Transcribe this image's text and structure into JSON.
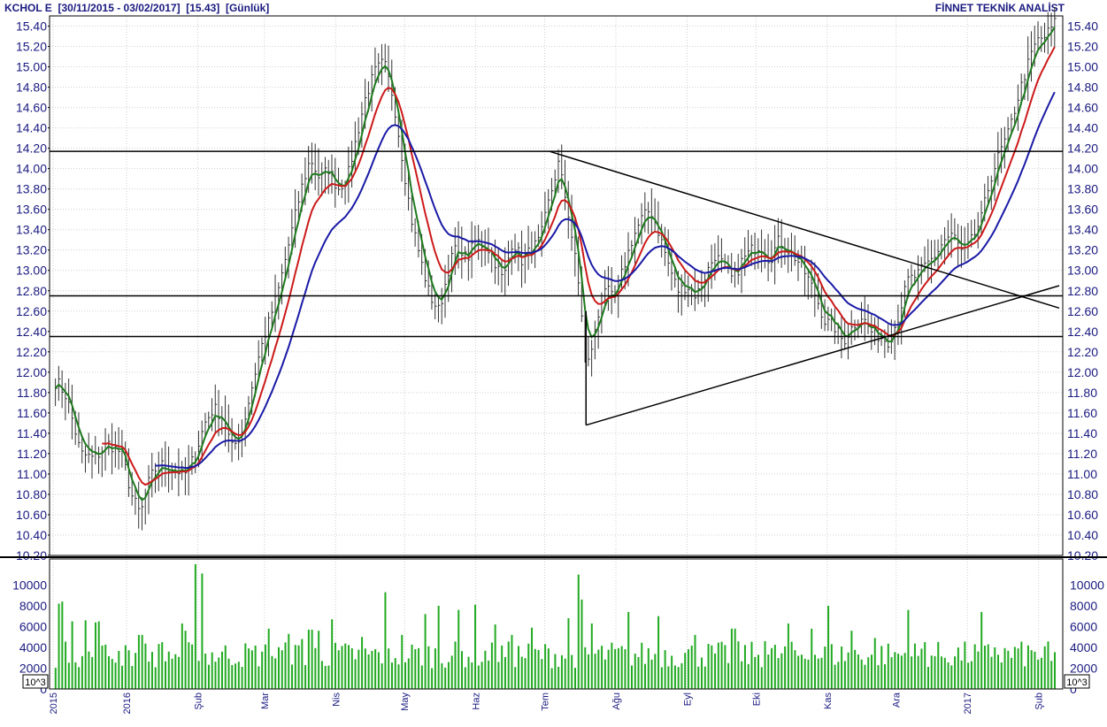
{
  "header": {
    "symbol": "KCHOL E",
    "range": "[30/11/2015 - 03/02/2017]",
    "last": "[15.43]",
    "period": "[Günlük]",
    "vendor": "FİNNET TEKNİK ANALİST"
  },
  "chart_data": [
    {
      "type": "line",
      "panel": "price",
      "chart_style": "ohlc-bars with moving averages",
      "y_ticks": [
        "15.40",
        "15.20",
        "15.00",
        "14.80",
        "14.60",
        "14.40",
        "14.20",
        "14.00",
        "13.80",
        "13.60",
        "13.40",
        "13.20",
        "13.00",
        "12.80",
        "12.60",
        "12.40",
        "12.20",
        "12.00",
        "11.80",
        "11.60",
        "11.40",
        "11.20",
        "11.00",
        "10.80",
        "10.60",
        "10.40",
        "10.20"
      ],
      "ylim": [
        10.2,
        15.5
      ],
      "x_ticks": [
        {
          "label": "2015",
          "day": 0
        },
        {
          "label": "2016",
          "day": 32
        },
        {
          "label": "Şub",
          "day": 63
        },
        {
          "label": "Mar",
          "day": 92
        },
        {
          "label": "Nis",
          "day": 123
        },
        {
          "label": "May",
          "day": 153
        },
        {
          "label": "Haz",
          "day": 184
        },
        {
          "label": "Tem",
          "day": 214
        },
        {
          "label": "Ağu",
          "day": 245
        },
        {
          "label": "Eyl",
          "day": 276
        },
        {
          "label": "Eki",
          "day": 306
        },
        {
          "label": "Kas",
          "day": 337
        },
        {
          "label": "Ara",
          "day": 367
        },
        {
          "label": "2017",
          "day": 398
        },
        {
          "label": "Şub",
          "day": 429
        }
      ],
      "x_domain_days": [
        0,
        438
      ],
      "grid": true,
      "close_anchors": [
        [
          2,
          11.9
        ],
        [
          6,
          11.75
        ],
        [
          12,
          11.2
        ],
        [
          18,
          11.15
        ],
        [
          24,
          11.3
        ],
        [
          30,
          11.2
        ],
        [
          34,
          10.8
        ],
        [
          38,
          10.6
        ],
        [
          42,
          10.95
        ],
        [
          46,
          11.1
        ],
        [
          52,
          11.05
        ],
        [
          58,
          11.0
        ],
        [
          62,
          11.2
        ],
        [
          66,
          11.5
        ],
        [
          70,
          11.65
        ],
        [
          74,
          11.55
        ],
        [
          78,
          11.25
        ],
        [
          82,
          11.4
        ],
        [
          86,
          11.8
        ],
        [
          90,
          12.2
        ],
        [
          94,
          12.5
        ],
        [
          98,
          12.8
        ],
        [
          104,
          13.4
        ],
        [
          108,
          13.8
        ],
        [
          112,
          14.1
        ],
        [
          116,
          13.9
        ],
        [
          120,
          14.0
        ],
        [
          124,
          13.8
        ],
        [
          128,
          13.9
        ],
        [
          132,
          14.3
        ],
        [
          136,
          14.7
        ],
        [
          140,
          14.95
        ],
        [
          144,
          15.05
        ],
        [
          148,
          14.7
        ],
        [
          152,
          14.1
        ],
        [
          156,
          13.5
        ],
        [
          160,
          13.1
        ],
        [
          164,
          12.75
        ],
        [
          168,
          12.6
        ],
        [
          172,
          13.0
        ],
        [
          176,
          13.3
        ],
        [
          180,
          13.1
        ],
        [
          184,
          13.3
        ],
        [
          190,
          13.2
        ],
        [
          196,
          12.9
        ],
        [
          200,
          13.3
        ],
        [
          204,
          13.1
        ],
        [
          208,
          13.2
        ],
        [
          212,
          13.3
        ],
        [
          216,
          13.7
        ],
        [
          220,
          14.05
        ],
        [
          224,
          13.6
        ],
        [
          228,
          13.0
        ],
        [
          230,
          12.6
        ],
        [
          232,
          12.0
        ],
        [
          236,
          12.4
        ],
        [
          240,
          12.85
        ],
        [
          244,
          12.7
        ],
        [
          248,
          13.0
        ],
        [
          252,
          13.3
        ],
        [
          256,
          13.5
        ],
        [
          260,
          13.6
        ],
        [
          264,
          13.35
        ],
        [
          268,
          13.05
        ],
        [
          272,
          12.8
        ],
        [
          276,
          12.85
        ],
        [
          280,
          12.75
        ],
        [
          284,
          12.95
        ],
        [
          288,
          13.15
        ],
        [
          292,
          13.05
        ],
        [
          296,
          12.9
        ],
        [
          300,
          13.1
        ],
        [
          304,
          13.2
        ],
        [
          308,
          13.25
        ],
        [
          312,
          13.1
        ],
        [
          316,
          13.3
        ],
        [
          320,
          13.2
        ],
        [
          324,
          13.1
        ],
        [
          328,
          12.95
        ],
        [
          332,
          12.75
        ],
        [
          336,
          12.5
        ],
        [
          340,
          12.45
        ],
        [
          344,
          12.3
        ],
        [
          348,
          12.45
        ],
        [
          352,
          12.55
        ],
        [
          356,
          12.4
        ],
        [
          360,
          12.35
        ],
        [
          364,
          12.3
        ],
        [
          368,
          12.55
        ],
        [
          372,
          12.9
        ],
        [
          376,
          12.95
        ],
        [
          380,
          13.05
        ],
        [
          384,
          13.15
        ],
        [
          388,
          13.3
        ],
        [
          392,
          13.35
        ],
        [
          396,
          13.15
        ],
        [
          400,
          13.3
        ],
        [
          404,
          13.5
        ],
        [
          408,
          13.9
        ],
        [
          412,
          14.15
        ],
        [
          416,
          14.35
        ],
        [
          420,
          14.7
        ],
        [
          424,
          15.0
        ],
        [
          428,
          15.25
        ],
        [
          432,
          15.3
        ],
        [
          436,
          15.43
        ]
      ]
    },
    {
      "type": "bar",
      "panel": "volume",
      "y_ticks": [
        "10000",
        "8000",
        "6000",
        "4000",
        "2000",
        "0"
      ],
      "ylim": [
        0,
        12500
      ],
      "unit_label": "10^3",
      "spikes": [
        [
          2,
          8200
        ],
        [
          4,
          8400
        ],
        [
          8,
          6500
        ],
        [
          14,
          6600
        ],
        [
          18,
          6400
        ],
        [
          20,
          6500
        ],
        [
          32,
          4200
        ],
        [
          38,
          5200
        ],
        [
          48,
          4500
        ],
        [
          56,
          6300
        ],
        [
          58,
          5600
        ],
        [
          62,
          12000
        ],
        [
          65,
          11100
        ],
        [
          94,
          5800
        ],
        [
          102,
          5300
        ],
        [
          108,
          4800
        ],
        [
          112,
          5700
        ],
        [
          116,
          5600
        ],
        [
          122,
          6700
        ],
        [
          134,
          5000
        ],
        [
          144,
          9300
        ],
        [
          152,
          5200
        ],
        [
          162,
          7200
        ],
        [
          168,
          8000
        ],
        [
          176,
          7600
        ],
        [
          184,
          8100
        ],
        [
          192,
          6200
        ],
        [
          200,
          5200
        ],
        [
          208,
          5900
        ],
        [
          224,
          6800
        ],
        [
          228,
          11000
        ],
        [
          230,
          8600
        ],
        [
          234,
          6300
        ],
        [
          250,
          7400
        ],
        [
          264,
          7000
        ],
        [
          280,
          5200
        ],
        [
          296,
          5800
        ],
        [
          310,
          4600
        ],
        [
          320,
          6300
        ],
        [
          330,
          5800
        ],
        [
          338,
          8000
        ],
        [
          348,
          5600
        ],
        [
          358,
          4900
        ],
        [
          372,
          7600
        ],
        [
          380,
          4500
        ],
        [
          404,
          7400
        ],
        [
          410,
          4000
        ],
        [
          420,
          3900
        ],
        [
          430,
          3000
        ],
        [
          434,
          2700
        ]
      ]
    }
  ],
  "overlays": {
    "colors": {
      "ma_fast": "#1e7a1e",
      "ma_mid": "#cc1a1a",
      "ma_slow": "#1a1aa6",
      "bars": "#333333",
      "volume": "#22aa22",
      "lines": "#000000",
      "axis_text": "#1a1a80"
    },
    "horizontal_levels": [
      14.17,
      12.75,
      12.35
    ],
    "trendlines": [
      {
        "from": [
          216,
          14.17
        ],
        "to": [
          438,
          12.63
        ]
      },
      {
        "from": [
          232,
          11.48
        ],
        "to": [
          438,
          12.85
        ]
      },
      {
        "from": [
          232,
          11.48
        ],
        "to": [
          232,
          12.6
        ]
      }
    ]
  }
}
